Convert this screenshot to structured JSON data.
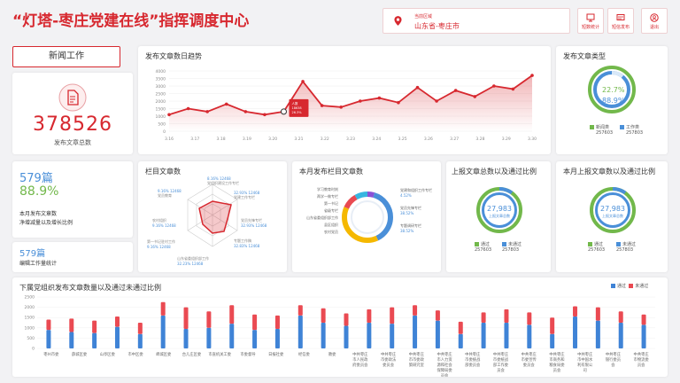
{
  "header": {
    "title": "“灯塔-枣庄党建在线”指挥调度中心",
    "region_label": "当前区域",
    "region_value": "山东省-枣庄市",
    "buttons": [
      {
        "label": "短数统计",
        "icon": "chart-icon"
      },
      {
        "label": "短信发布",
        "icon": "message-icon"
      },
      {
        "label": "退出",
        "icon": "user-icon"
      }
    ]
  },
  "news": {
    "button_label": "新闻工作",
    "total_value": "378526",
    "total_label": "发布文章总数",
    "monthly_count": "579篇",
    "monthly_rate": "88.9%",
    "monthly_label1": "本月发布文章数",
    "monthly_label2": "净增减量以及增长比例",
    "workload_value": "579篇",
    "workload_label": "编辑工作量统计"
  },
  "trend": {
    "title": "发布文章数日趋势",
    "tooltip": {
      "label": "人数",
      "value": "18638",
      "rate": "26.3%"
    }
  },
  "type_card": {
    "title": "发布文章类型",
    "pct_green": "22.7%",
    "pct_blue": "88.9%",
    "legend": [
      {
        "label": "新闻类",
        "value": "257603",
        "color": "#72b84b"
      },
      {
        "label": "工作类",
        "value": "257803",
        "color": "#4a8fd8"
      }
    ]
  },
  "column_card": {
    "title": "栏目文章数",
    "labels": [
      {
        "line1": "8.16% 12468",
        "line2": "党组织建设工作专栏"
      },
      {
        "line1": "32.93% 12468",
        "line2": "党建工作专栏"
      },
      {
        "line1": "32.93% 12468",
        "line2": "党员先锋专栏"
      },
      {
        "line1": "32.83% 12468",
        "line2": "专题工作稿"
      },
      {
        "line1": "32.23% 12468",
        "line2": "山东省委组织部工作"
      },
      {
        "line1": "9.16% 12468",
        "line2": "第一书记驻村工作"
      },
      {
        "line1": "9.16% 12468",
        "line2": "农村组织"
      },
      {
        "line1": "9.16% 12468",
        "line2": "党员教育"
      }
    ]
  },
  "month_column_card": {
    "title": "本月发布栏目文章数",
    "left_labels": [
      "学习教育时刻",
      "两学一做专栏",
      "第一书记",
      "省级专栏",
      "山东省委组织部工作",
      "县区组织",
      "农村党员"
    ],
    "right_labels": [
      {
        "line1": "党建和组织工作专栏",
        "line2": "4.52%"
      },
      {
        "line1": "党员先锋专栏",
        "line2": "38.52%"
      },
      {
        "line1": "专题调研专栏",
        "line2": "38.52%"
      }
    ]
  },
  "report_total": {
    "title": "上报文章总数以及通过比例",
    "center_value": "27,983",
    "center_label": "上报文章总数",
    "legend": [
      {
        "label": "通过",
        "value": "257603",
        "color": "#72b84b"
      },
      {
        "label": "未通过",
        "value": "257803",
        "color": "#4a8fd8"
      }
    ]
  },
  "report_month": {
    "title": "本月上报文章数以及通过比例",
    "center_value": "27,983",
    "center_label": "上报文章总数",
    "legend": [
      {
        "label": "通过",
        "value": "257603",
        "color": "#72b84b"
      },
      {
        "label": "未通过",
        "value": "257803",
        "color": "#4a8fd8"
      }
    ]
  },
  "org_card": {
    "title": "下属党组织发布文章数量以及通过未通过比例",
    "legend_pass": "通过",
    "legend_fail": "未通过"
  },
  "chart_data": [
    {
      "type": "line",
      "title": "发布文章数日趋势",
      "x": [
        "3.16",
        "3.17",
        "3.18",
        "3.19",
        "3.20",
        "3.21",
        "3.22",
        "3.23",
        "3.24",
        "3.25",
        "3.26",
        "3.27",
        "3.28",
        "3.29",
        "3.30"
      ],
      "values": [
        1100,
        1500,
        1300,
        1800,
        1300,
        1100,
        1300,
        3300,
        1700,
        1600,
        2000,
        2200,
        1900,
        2900,
        2000,
        2700,
        2300,
        3000,
        2800,
        3700
      ],
      "y_ticks": [
        0,
        500,
        1000,
        1500,
        2000,
        2500,
        3000,
        3500,
        4000
      ],
      "ylim": [
        0,
        4000
      ],
      "color": "#d7282f"
    },
    {
      "type": "bar",
      "title": "下属党组织发布文章数量以及通过未通过比例",
      "categories": [
        "枣州市委",
        "薛城区委",
        "山亭区委",
        "市中区委",
        "峄城区委",
        "台儿庄区委",
        "市直机关工委",
        "市委督导",
        "日报社委",
        "经信委",
        "教委",
        "中共枣庄市人民政府委员会",
        "中共枣庄市委政法委员会",
        "中共枣庄市市委政策研究室",
        "中共枣庄市人力资源和社会保障局委员会",
        "中共枣庄市委统战部委员会",
        "中共枣庄市委统战部工作委员会",
        "中共枣庄市委宣传委员会",
        "中共枣庄市商务和粮食局委员会",
        "中共枣庄市中国水利有限公司",
        "中共枣庄银行委员会",
        "中共枣庄市物流委员会"
      ],
      "series": [
        {
          "name": "通过",
          "color": "#3f83d6",
          "values": [
            900,
            800,
            750,
            1050,
            700,
            1600,
            950,
            1000,
            1200,
            900,
            950,
            1600,
            1250,
            1100,
            1250,
            1200,
            1600,
            1350,
            700,
            1250,
            1250,
            1150,
            700,
            1550,
            1350,
            1250,
            1150
          ]
        },
        {
          "name": "未通过",
          "color": "#ea4a52",
          "values": [
            500,
            650,
            600,
            500,
            550,
            650,
            1050,
            800,
            900,
            750,
            650,
            500,
            700,
            600,
            650,
            800,
            500,
            500,
            600,
            500,
            650,
            600,
            800,
            500,
            650,
            550,
            500
          ]
        }
      ],
      "ylim": [
        0,
        2500
      ],
      "y_ticks": [
        0,
        500,
        1000,
        1500,
        2000,
        2500
      ]
    },
    {
      "type": "pie",
      "title": "本月发布栏目文章数",
      "values": [
        4.52,
        38.52,
        38.52,
        10,
        8.44
      ],
      "colors": [
        "#8a52d6",
        "#4a8fd8",
        "#f5b800",
        "#e94a52",
        "#37b6e0"
      ]
    }
  ]
}
